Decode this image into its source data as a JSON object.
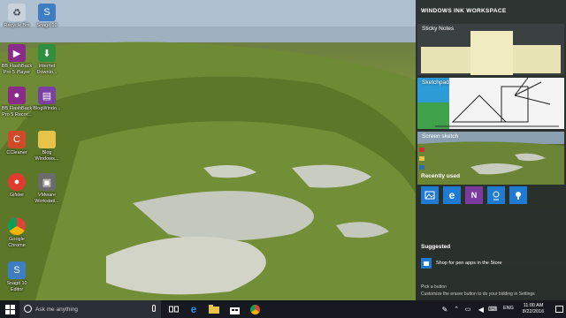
{
  "desktop": {
    "icons": [
      {
        "label": "Recycle Bin"
      },
      {
        "label": "Snagit 10"
      },
      {
        "label": "BB FlashBack Pro 5 Player"
      },
      {
        "label": "Internet Downlo..."
      },
      {
        "label": "BB FlashBack Pro 5 Recor..."
      },
      {
        "label": "BlogWindo..."
      },
      {
        "label": "CCleaner"
      },
      {
        "label": "Blog Windows..."
      },
      {
        "label": "Gifster"
      },
      {
        "label": "VMware Workstati..."
      },
      {
        "label": "Google Chrome"
      },
      {
        "label": "Snagit 10 Editor"
      }
    ]
  },
  "ink_workspace": {
    "title": "WINDOWS INK WORKSPACE",
    "sticky_notes_label": "Sticky Notes",
    "sketchpad_label": "Sketchpad",
    "screen_sketch_label": "Screen sketch",
    "recently_used_label": "Recently used",
    "recent_apps": [
      "photos-icon",
      "edge-icon",
      "onenote-icon",
      "maps-icon",
      "tips-icon"
    ],
    "suggested_label": "Suggested",
    "suggestion_text": "Shop for pen apps in the Store",
    "pick_button_title": "Pick a button",
    "pick_button_text": "Customize the eraser button to do your bidding in Settings",
    "accent_color": "#1f7ad2"
  },
  "taskbar": {
    "search_placeholder": "Ask me anything",
    "language": "ENG",
    "time": "11:00 AM",
    "date": "8/22/2016"
  }
}
